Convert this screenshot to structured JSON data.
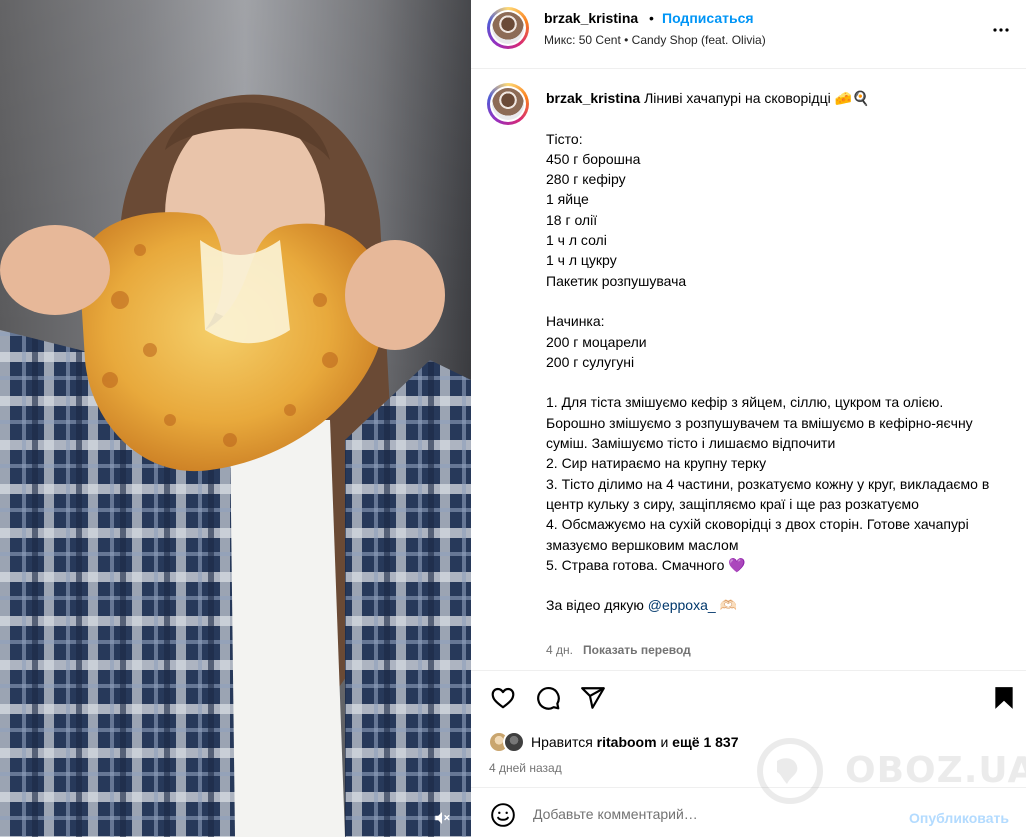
{
  "header": {
    "username": "brzak_kristina",
    "separator": "•",
    "follow_label": "Подписаться",
    "music": "Микс: 50 Cent • Candy Shop (feat. Olivia)"
  },
  "caption": {
    "author": "brzak_kristina",
    "title": "Ліниві хачапурі на сковорідці 🧀🍳",
    "lines": [
      "",
      "Тісто:",
      "450 г борошна",
      "280 г кефіру",
      "1 яйце",
      "18 г олії",
      "1 ч л солі",
      "1 ч л цукру",
      "Пакетик розпушувача",
      "",
      "Начинка:",
      "200 г моцарели",
      "200 г сулугуні",
      "",
      "1. Для тіста змішуємо кефір з яйцем, сіллю, цукром та олією. Борошно змішуємо з розпушувачем та вмішуємо в кефірно-яєчну суміш. Замішуємо тісто і лишаємо відпочити",
      "2. Сир натираємо на крупну терку",
      "3. Тісто ділимо на 4 частини, розкатуємо кожну у круг, викладаємо в центр кульку з сиру, защіпляємо краї і ще раз розкатуємо",
      "4. Обсмажуємо на сухій сковорідці з двох сторін. Готове хачапурі змазуємо вершковим маслом",
      "5. Страва готова. Смачного 💜",
      ""
    ],
    "thanks_prefix": "За відео дякую ",
    "mention": "@eppoxa_",
    "thanks_suffix": " 🫶🏻",
    "age": "4 дн.",
    "translate_label": "Показать перевод"
  },
  "actions": {
    "like_icon": "heart-icon",
    "comment_icon": "comment-bubble-icon",
    "share_icon": "paper-plane-icon",
    "save_icon": "bookmark-icon"
  },
  "likes": {
    "prefix": "Нравится ",
    "user": "ritaboom",
    "middle": " и ",
    "count_text": "ещё 1 837"
  },
  "post_time": "4 дней назад",
  "comment": {
    "placeholder": "Добавьте комментарий…",
    "publish_label": "Опубликовать"
  },
  "watermark": "OBOZ.UA",
  "colors": {
    "follow": "#0095f6",
    "publish_disabled": "#b3dbff",
    "secondary_text": "#737373",
    "mention": "#00376b"
  }
}
